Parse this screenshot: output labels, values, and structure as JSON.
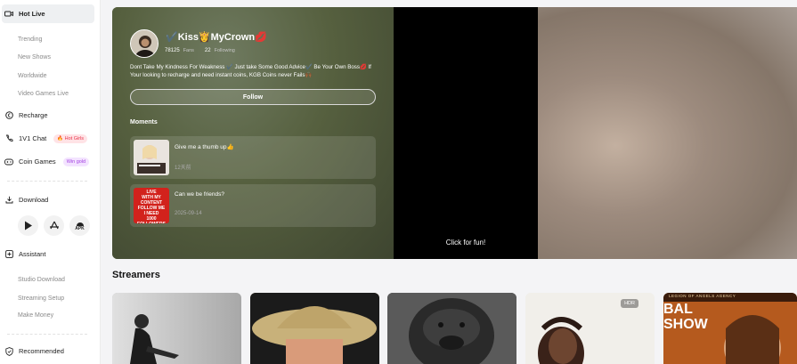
{
  "sidebar": {
    "hot_live": "Hot Live",
    "sub_items": [
      "Trending",
      "New Shows",
      "Worldwide",
      "Video Games Live"
    ],
    "recharge": "Recharge",
    "one_v_one": "1V1 Chat",
    "hot_girls_badge": "🔥 Hot Girls",
    "coin_games": "Coin Games",
    "win_gold_badge": "Win gold",
    "download": "Download",
    "download_icons": [
      "google-play-icon",
      "app-store-icon",
      "apk-icon"
    ],
    "apk_label": "APK",
    "assistant": "Assistant",
    "assistant_items": [
      "Studio Download",
      "Streaming Setup",
      "Make Money"
    ],
    "recommended": "Recommended"
  },
  "hero": {
    "streamer_name": "✔️Kiss👸MyCrown💋",
    "fans_count": "78125",
    "fans_label": "Fans",
    "following_count": "22",
    "following_label": "Following",
    "bio": "Dont Take My Kindness For Weakness ✔️ Just take Some Good Advice✔️ Be Your Own Boss💋 If Your looking to recharge and need instant coins, KGB Coins never Fails🙌🏾",
    "follow_label": "Follow",
    "moments_title": "Moments",
    "moments": [
      {
        "text": "Give me a thumb up👍",
        "date": "12天前"
      },
      {
        "text": "Can we be friends?",
        "date": "2025-09-14",
        "thumb_text": "LIVE\nWITH MY CONTENT\nFOLLOW ME\nI NEED\n1000\nFOLLOWERS"
      }
    ],
    "click_for_fun": "Click for fun!"
  },
  "streamers": {
    "title": "Streamers",
    "cards": [
      {
        "bg": "#bdbdbd"
      },
      {
        "bg": "#8a6a3a"
      },
      {
        "bg": "#2c2c2c"
      },
      {
        "bg": "#f1efea",
        "badge": "HDR"
      },
      {
        "bg": "#b55a1e",
        "text": "BAL SHOW",
        "header": "LEGION OF ANGELS AGENCY"
      }
    ]
  }
}
